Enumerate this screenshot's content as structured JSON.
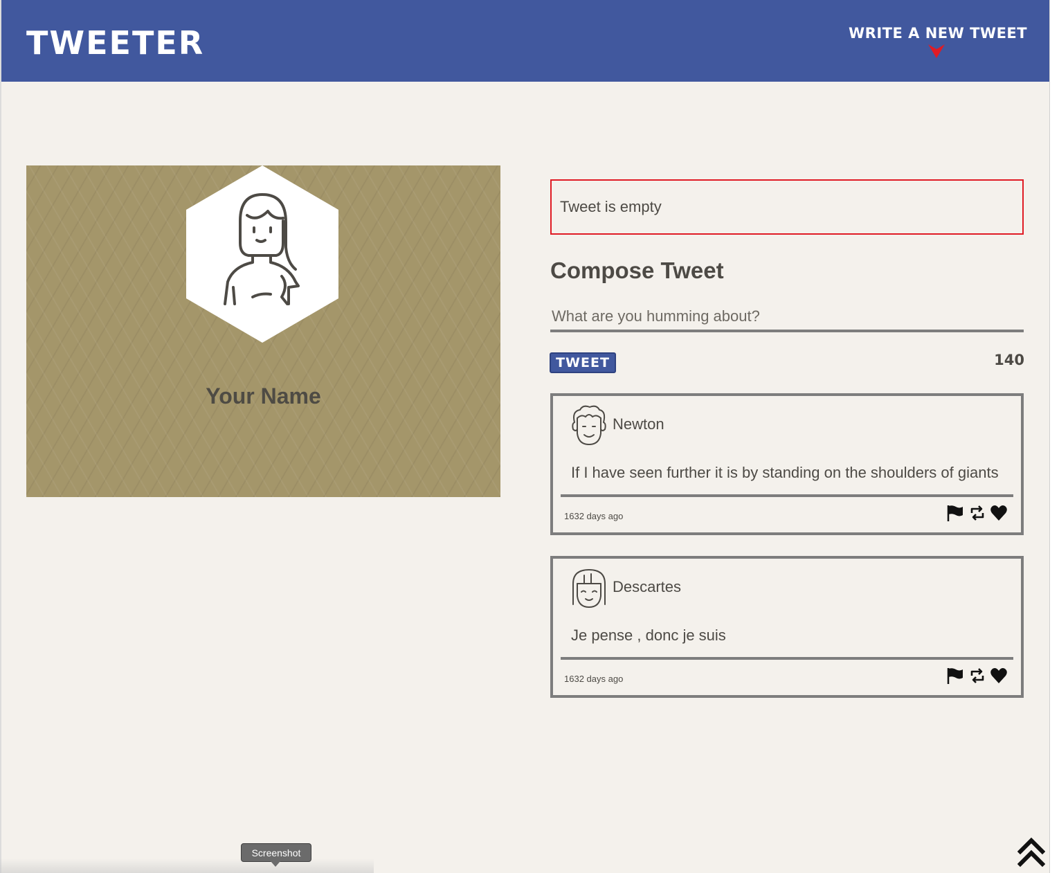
{
  "header": {
    "logo": "TWEETER",
    "write_link": "WRITE A NEW TWEET",
    "arrow_icon": "arrow-down-icon",
    "arrow_color": "#e01b24",
    "background_color": "#41589e"
  },
  "profile": {
    "name": "Your Name",
    "avatar_icon": "woman-avatar-icon",
    "background_color": "#a4966a"
  },
  "compose": {
    "error_message": "Tweet is empty",
    "error_color": "#e01b24",
    "title": "Compose Tweet",
    "input_value": "",
    "input_placeholder": "What are you humming about?",
    "button_label": "TWEET",
    "char_counter": "140"
  },
  "tweets": [
    {
      "author": "Newton",
      "avatar_icon": "curly-hair-avatar-icon",
      "text": "If I have seen further it is by standing on the shoulders of giants",
      "time": "1632 days ago",
      "actions": [
        "flag-icon",
        "retweet-icon",
        "heart-icon"
      ]
    },
    {
      "author": "Descartes",
      "avatar_icon": "bob-hair-avatar-icon",
      "text": "Je pense , donc je suis",
      "time": "1632 days ago",
      "actions": [
        "flag-icon",
        "retweet-icon",
        "heart-icon"
      ]
    }
  ],
  "overlay": {
    "tooltip": "Screenshot",
    "scroll_top_icon": "double-chevron-up-icon"
  }
}
